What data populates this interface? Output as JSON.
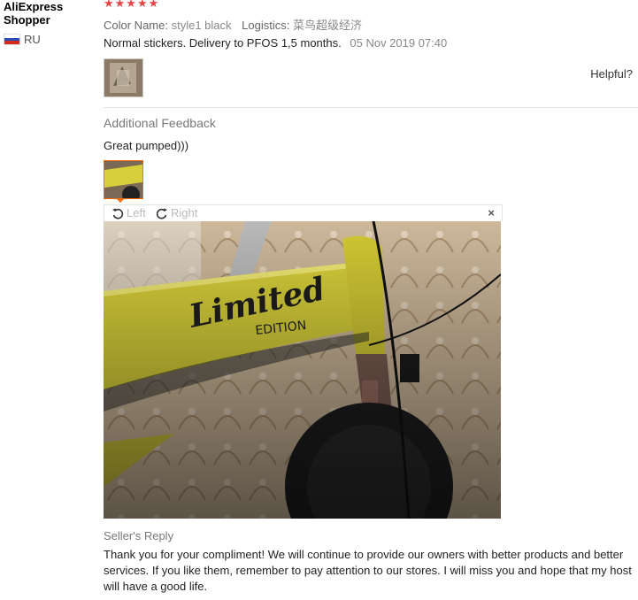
{
  "reviewer": {
    "name": "AliExpress Shopper",
    "country": "RU"
  },
  "rating": {
    "stars": 5,
    "glyphs": "★★★★★"
  },
  "meta": {
    "color_key": "Color Name:",
    "color_value": "style1 black",
    "logistics_key": "Logistics:",
    "logistics_value": "菜鸟超级经济"
  },
  "review": {
    "text": "Normal stickers. Delivery to PFOS 1,5 months.",
    "date": "05 Nov 2019 07:40"
  },
  "helpful_label": "Helpful?",
  "additional": {
    "label": "Additional Feedback",
    "text": "Great pumped)))"
  },
  "viewer": {
    "rotate_left": "Left",
    "rotate_right": "Right",
    "close": "×",
    "sticker_line1": "Limited",
    "sticker_line2": "EDITION"
  },
  "seller_reply": {
    "label": "Seller's Reply",
    "text": "Thank you for your compliment! We will continue to provide our owners with better products and better services. If you like them, remember to pay attention to our stores. I will miss you and hope that my host will have a good life."
  },
  "colors": {
    "star": "#e64545",
    "bike_yellow": "#d8d03a",
    "wallpaper": "#cdb89a"
  },
  "icons": {
    "rotate_left": "rotate-left-icon",
    "rotate_right": "rotate-right-icon",
    "close": "close-icon"
  }
}
